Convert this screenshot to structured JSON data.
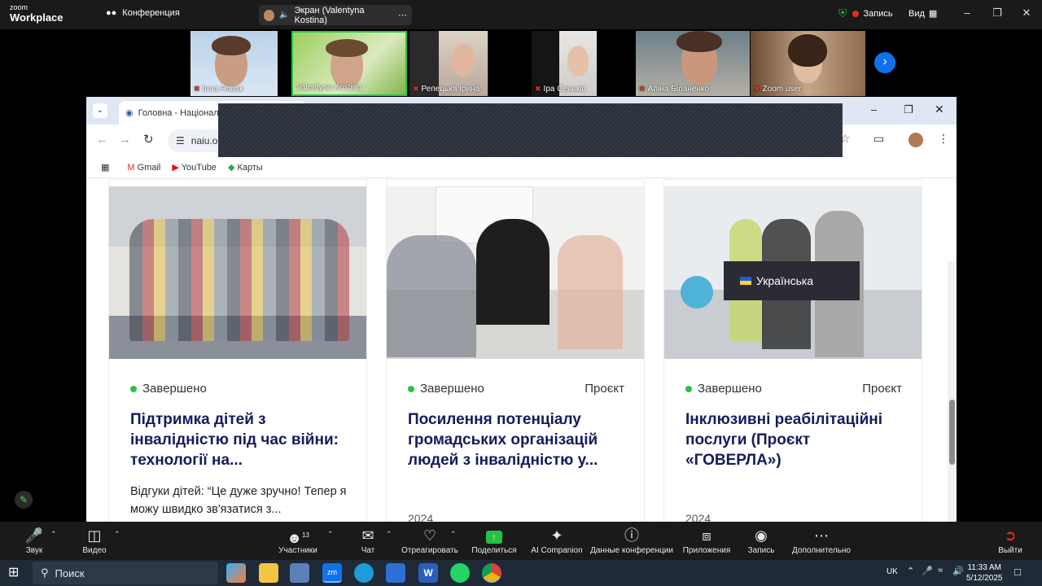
{
  "zoom": {
    "logo_line1": "zoom",
    "logo_line2": "Workplace",
    "meeting_title": "Конференция",
    "share_label": "Экран (Valentyna Kostina)",
    "record_status": "Запись",
    "view_label": "Вид",
    "participants": [
      {
        "name": "Інна Новак",
        "muted": true
      },
      {
        "name": "Valentyna Kostina",
        "muted": false
      },
      {
        "name": "Репецька Ірина",
        "muted": true
      },
      {
        "name": "Іра Сеньків",
        "muted": true
      },
      {
        "name": "Аліна Біланенко",
        "muted": true
      },
      {
        "name": "Zoom user",
        "muted": true
      }
    ],
    "toolbar": [
      {
        "label": "Звук",
        "icon": "mic-muted-icon"
      },
      {
        "label": "Видео",
        "icon": "camera-icon"
      },
      {
        "label": "Участники",
        "icon": "participants-icon",
        "count": "13"
      },
      {
        "label": "Чат",
        "icon": "chat-icon"
      },
      {
        "label": "Отреагировать",
        "icon": "heart-icon"
      },
      {
        "label": "Поделиться",
        "icon": "share-screen-icon"
      },
      {
        "label": "AI Companion",
        "icon": "sparkle-icon"
      },
      {
        "label": "Данные конференции",
        "icon": "info-icon"
      },
      {
        "label": "Приложения",
        "icon": "apps-icon"
      },
      {
        "label": "Запись",
        "icon": "record-icon"
      },
      {
        "label": "Дополнительно",
        "icon": "more-icon"
      },
      {
        "label": "Выйти",
        "icon": "leave-icon"
      }
    ]
  },
  "browser": {
    "tab_title": "Головна - Національ",
    "url": "naiu.o",
    "bookmarks": [
      "Gmail",
      "YouTube",
      "Карты"
    ],
    "language": "Українська",
    "cards": [
      {
        "status": "Завершено",
        "kind": "",
        "title": "Підтримка дітей з інвалідністю під час війни: технології на...",
        "description": "Відгуки дітей: “Це дуже зручно! Тепер я можу швидко зв'язатися з...",
        "year": ""
      },
      {
        "status": "Завершено",
        "kind": "Проєкт",
        "title": "Посилення потенціалу громадських організацій людей з інвалідністю у...",
        "description": "",
        "year": "2024"
      },
      {
        "status": "Завершено",
        "kind": "Проєкт",
        "title": "Інклюзивні реабілітаційні послуги (Проєкт «ГОВЕРЛА»)",
        "description": "",
        "year": "2024"
      }
    ]
  },
  "taskbar": {
    "search_placeholder": "Поиск",
    "language": "UK",
    "time": "11:33 AM",
    "date": "5/12/2025"
  },
  "colors": {
    "accent": "#0e72ed",
    "title_navy": "#151b5e",
    "status_green": "#2bc04a",
    "record_red": "#e0301e"
  }
}
